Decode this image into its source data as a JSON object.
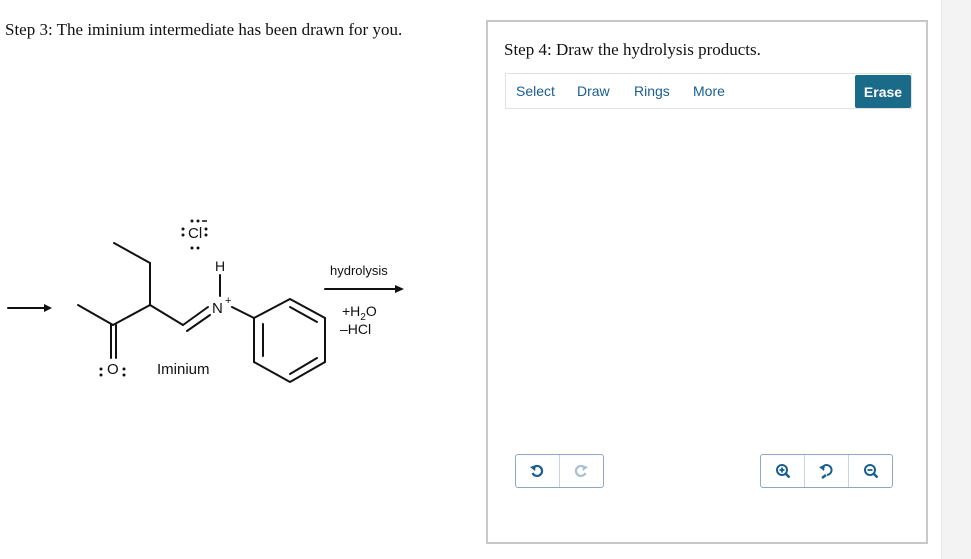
{
  "step3": {
    "title": "Step 3: The iminium intermediate has been drawn for you."
  },
  "molecule": {
    "chlorine_label": "Cl",
    "nitrogen_label": "N",
    "nitrogen_charge": "+",
    "hydrogen_label": "H",
    "oxygen_label": "O",
    "iminium_label": "Iminium"
  },
  "reaction": {
    "arrow_label": "hydrolysis",
    "reagent_add_prefix": "+H",
    "reagent_add_subscript": "2",
    "reagent_add_suffix": "O",
    "reagent_remove": "–HCl"
  },
  "step4": {
    "title": "Step 4: Draw the hydrolysis products."
  },
  "toolbar": {
    "select": "Select",
    "draw": "Draw",
    "rings": "Rings",
    "more": "More",
    "erase": "Erase"
  },
  "controls": {
    "undo_icon": "undo-icon",
    "redo_icon": "redo-icon",
    "zoom_in_icon": "zoom-in-icon",
    "zoom_reset_icon": "zoom-reset-icon",
    "zoom_out_icon": "zoom-out-icon"
  },
  "colors": {
    "accent": "#1a6a8a",
    "link": "#1a5e8f"
  }
}
